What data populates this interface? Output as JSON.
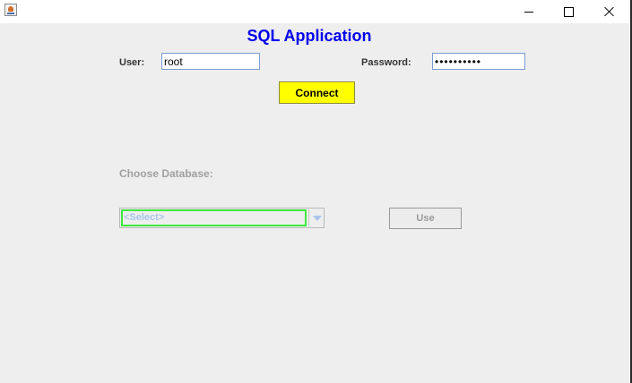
{
  "window": {
    "icon": "java-cup-icon",
    "controls": {
      "minimize": "minimize-icon",
      "maximize": "maximize-icon",
      "close": "close-icon"
    }
  },
  "app": {
    "title": "SQL Application",
    "title_color": "#0000ee"
  },
  "login": {
    "user_label": "User:",
    "user_value": "root",
    "password_label": "Password:",
    "password_masked": "••••••••••",
    "connect_label": "Connect",
    "connect_color": "#ffff00"
  },
  "database": {
    "choose_label": "Choose Database:",
    "select_value": "<Select>",
    "use_label": "Use",
    "enabled": false
  }
}
